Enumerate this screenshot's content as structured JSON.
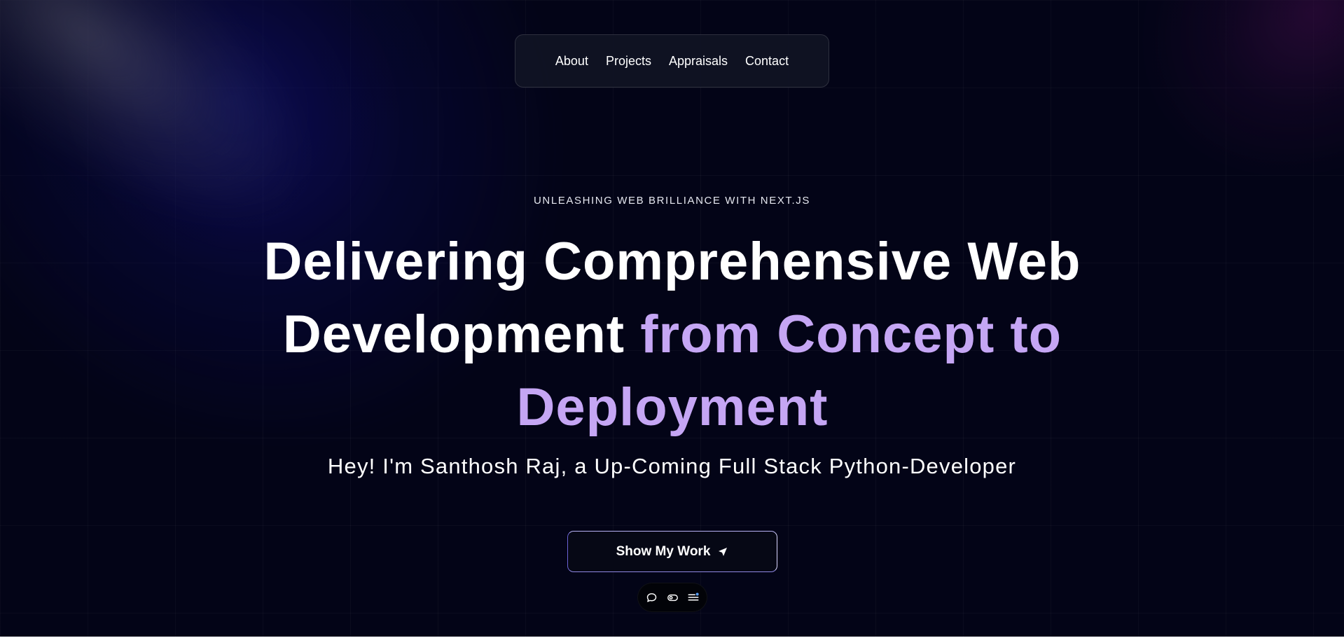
{
  "nav": {
    "items": [
      {
        "label": "About"
      },
      {
        "label": "Projects"
      },
      {
        "label": "Appraisals"
      },
      {
        "label": "Contact"
      }
    ]
  },
  "hero": {
    "eyebrow": "UNLEASHING WEB BRILLIANCE WITH NEXT.JS",
    "headline_white": "Delivering Comprehensive Web Development",
    "headline_accent": "from Concept to Deployment",
    "subline": "Hey! I'm Santhosh Raj, a Up-Coming Full Stack Python-Developer",
    "cta_label": "Show My Work",
    "cta_icon": "send-arrow-icon"
  },
  "mini_toolbar": {
    "icons": [
      "chat-bubble-icon",
      "toggle-icon",
      "list-menu-icon"
    ]
  },
  "colors": {
    "background": "#030417",
    "accent": "#c5a6f4",
    "text": "#ffffff",
    "cta_border": "#6b63d6"
  }
}
